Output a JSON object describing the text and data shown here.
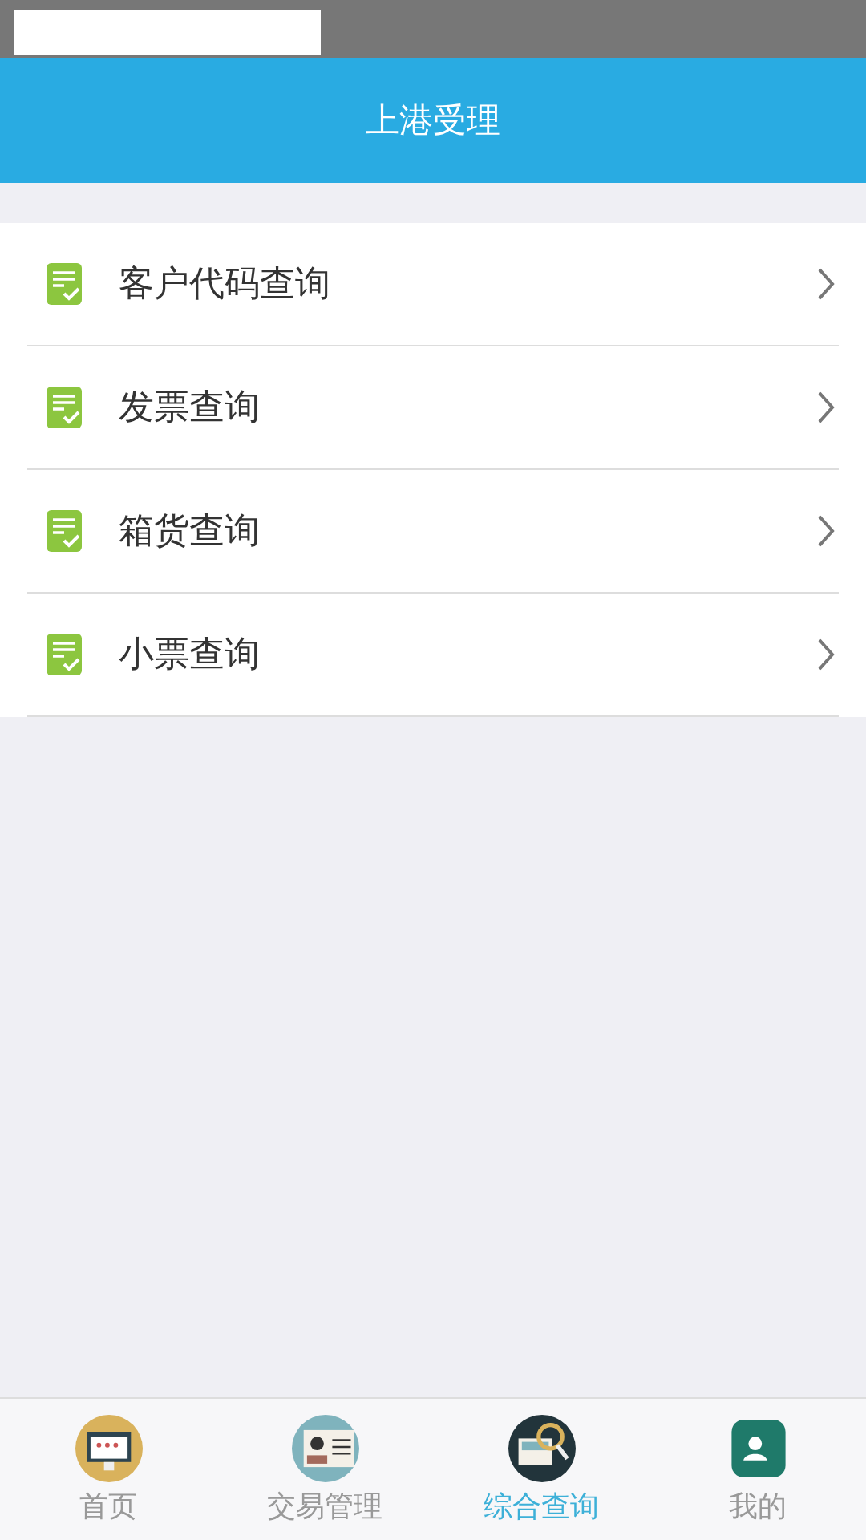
{
  "header": {
    "title": "上港受理"
  },
  "menu": [
    {
      "label": "客户代码查询"
    },
    {
      "label": "发票查询"
    },
    {
      "label": "箱货查询"
    },
    {
      "label": "小票查询"
    }
  ],
  "tabs": [
    {
      "label": "首页",
      "kind": "home",
      "selected": false
    },
    {
      "label": "交易管理",
      "kind": "card",
      "selected": false
    },
    {
      "label": "综合查询",
      "kind": "search",
      "selected": true
    },
    {
      "label": "我的",
      "kind": "user",
      "selected": false
    }
  ]
}
